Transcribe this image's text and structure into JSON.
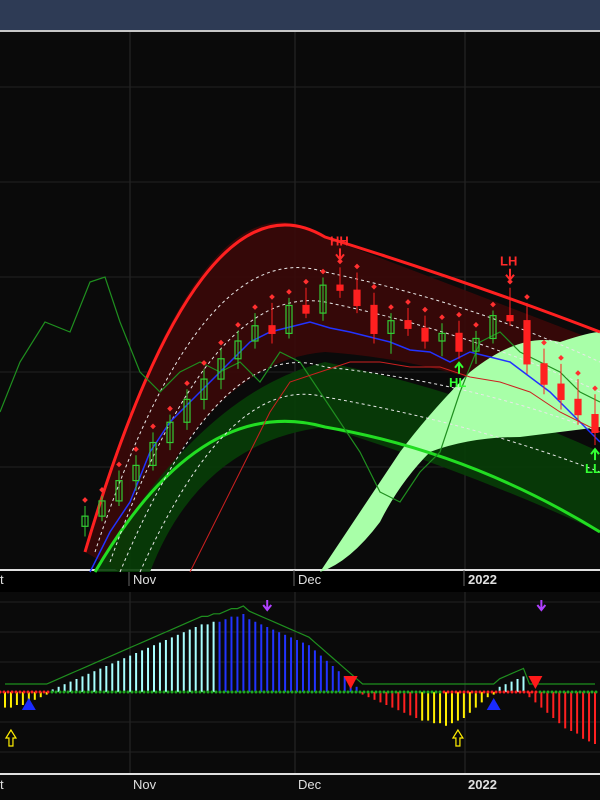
{
  "chart_data": [
    {
      "type": "candlestick",
      "panel": "price",
      "x_tick_labels": [
        "Nov",
        "Dec",
        "2022"
      ],
      "x_tick_label_emphasis": [
        "normal",
        "normal",
        "bold"
      ],
      "left_edge_label_fragment": "t",
      "ohlc_sample": [
        {
          "o": 168,
          "h": 176,
          "l": 164,
          "c": 172
        },
        {
          "o": 172,
          "h": 180,
          "l": 170,
          "c": 178
        },
        {
          "o": 178,
          "h": 190,
          "l": 176,
          "c": 186
        },
        {
          "o": 186,
          "h": 196,
          "l": 182,
          "c": 192
        },
        {
          "o": 192,
          "h": 205,
          "l": 190,
          "c": 201
        },
        {
          "o": 201,
          "h": 212,
          "l": 198,
          "c": 209
        },
        {
          "o": 209,
          "h": 222,
          "l": 206,
          "c": 218
        },
        {
          "o": 218,
          "h": 230,
          "l": 214,
          "c": 226
        },
        {
          "o": 226,
          "h": 238,
          "l": 222,
          "c": 234
        },
        {
          "o": 234,
          "h": 245,
          "l": 230,
          "c": 241
        },
        {
          "o": 241,
          "h": 252,
          "l": 238,
          "c": 247
        },
        {
          "o": 247,
          "h": 256,
          "l": 240,
          "c": 244
        },
        {
          "o": 244,
          "h": 258,
          "l": 242,
          "c": 255
        },
        {
          "o": 255,
          "h": 262,
          "l": 250,
          "c": 252
        },
        {
          "o": 252,
          "h": 266,
          "l": 249,
          "c": 263
        },
        {
          "o": 263,
          "h": 270,
          "l": 258,
          "c": 261
        },
        {
          "o": 261,
          "h": 268,
          "l": 252,
          "c": 255
        },
        {
          "o": 255,
          "h": 260,
          "l": 240,
          "c": 244
        },
        {
          "o": 244,
          "h": 252,
          "l": 236,
          "c": 249
        },
        {
          "o": 249,
          "h": 254,
          "l": 243,
          "c": 246
        },
        {
          "o": 246,
          "h": 251,
          "l": 238,
          "c": 241
        },
        {
          "o": 241,
          "h": 248,
          "l": 235,
          "c": 244
        },
        {
          "o": 244,
          "h": 249,
          "l": 234,
          "c": 237
        },
        {
          "o": 237,
          "h": 245,
          "l": 232,
          "c": 242
        },
        {
          "o": 242,
          "h": 253,
          "l": 240,
          "c": 251
        },
        {
          "o": 251,
          "h": 262,
          "l": 247,
          "c": 249
        },
        {
          "o": 249,
          "h": 256,
          "l": 228,
          "c": 232
        },
        {
          "o": 232,
          "h": 238,
          "l": 220,
          "c": 224
        },
        {
          "o": 224,
          "h": 232,
          "l": 214,
          "c": 218
        },
        {
          "o": 218,
          "h": 226,
          "l": 208,
          "c": 212
        },
        {
          "o": 212,
          "h": 220,
          "l": 200,
          "c": 205
        }
      ],
      "annotations": [
        {
          "text": "HH",
          "color": "#ff2a2a",
          "at_index": 15
        },
        {
          "text": "LH",
          "color": "#ff2a2a",
          "at_index": 25
        },
        {
          "text": "HL",
          "color": "#33ff33",
          "at_index": 22
        },
        {
          "text": "LL",
          "color": "#33ff33",
          "at_index": 30
        }
      ],
      "colors": {
        "up_candle": "#33cc33",
        "down_candle": "#ff2020",
        "upper_band": "#ff2020",
        "lower_band": "#22dd22",
        "cloud": "#a8ffa8",
        "blue_line": "#2233ff",
        "green_line": "#1f8f1f"
      },
      "grid": true
    },
    {
      "type": "bar",
      "panel": "oscillator",
      "x_tick_labels": [
        "Nov",
        "Dec",
        "2022"
      ],
      "x_tick_label_emphasis": [
        "normal",
        "normal",
        "bold"
      ],
      "left_edge_label_fragment": "t",
      "values": [
        -6,
        -6,
        -5,
        -5,
        -4,
        -3,
        -2,
        -1,
        1,
        2,
        3,
        4,
        5,
        6,
        7,
        8,
        9,
        10,
        11,
        12,
        13,
        14,
        15,
        16,
        17,
        18,
        19,
        20,
        21,
        22,
        23,
        24,
        25,
        26,
        26,
        27,
        27,
        28,
        29,
        29,
        30,
        28,
        27,
        26,
        25,
        24,
        23,
        22,
        21,
        20,
        19,
        18,
        16,
        14,
        12,
        10,
        8,
        6,
        4,
        2,
        -1,
        -2,
        -3,
        -4,
        -5,
        -6,
        -7,
        -8,
        -9,
        -10,
        -11,
        -11,
        -12,
        -12,
        -13,
        -12,
        -11,
        -10,
        -8,
        -6,
        -4,
        -2,
        -1,
        2,
        3,
        4,
        5,
        6,
        -2,
        -4,
        -6,
        -8,
        -10,
        -12,
        -14,
        -15,
        -16,
        -18,
        -19,
        -20
      ],
      "bar_colors_by_phase": [
        "yellow",
        "cyan",
        "blue",
        "red",
        "yellow",
        "cyan",
        "red"
      ],
      "signals": [
        {
          "shape": "up-triangle",
          "color": "#1a2bff",
          "at_index": 4
        },
        {
          "shape": "down-triangle",
          "color": "#ff1a1a",
          "at_index": 58
        },
        {
          "shape": "up-triangle",
          "color": "#1a2bff",
          "at_index": 82
        },
        {
          "shape": "down-triangle",
          "color": "#ff1a1a",
          "at_index": 89
        },
        {
          "shape": "hollow-up-arrow",
          "color": "#ffee00",
          "at_index": 1
        },
        {
          "shape": "hollow-up-arrow",
          "color": "#ffee00",
          "at_index": 76
        },
        {
          "shape": "down-arrow",
          "color": "#b040ff",
          "at_index": 44
        },
        {
          "shape": "down-arrow",
          "color": "#b040ff",
          "at_index": 90
        }
      ],
      "grid": true
    }
  ]
}
